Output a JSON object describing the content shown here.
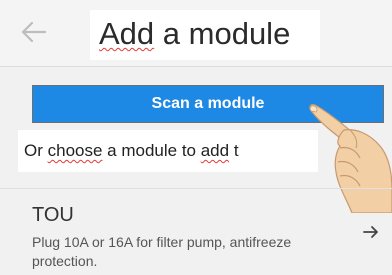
{
  "header": {
    "title_prefix": "Add",
    "title_rest": " a module",
    "back_icon": "back-arrow-icon"
  },
  "scan": {
    "label": "Scan a module"
  },
  "choose": {
    "prefix": "Or ",
    "word1": "choose",
    "middle": " a module to ",
    "word2": "add",
    "suffix": " t"
  },
  "modules": [
    {
      "name": "TOU",
      "description": "Plug 10A or 16A for filter pump, antifreeze protection.",
      "icon": "arrow-right-icon"
    }
  ],
  "colors": {
    "accent": "#1e88e5",
    "background": "#f1f1f1"
  }
}
